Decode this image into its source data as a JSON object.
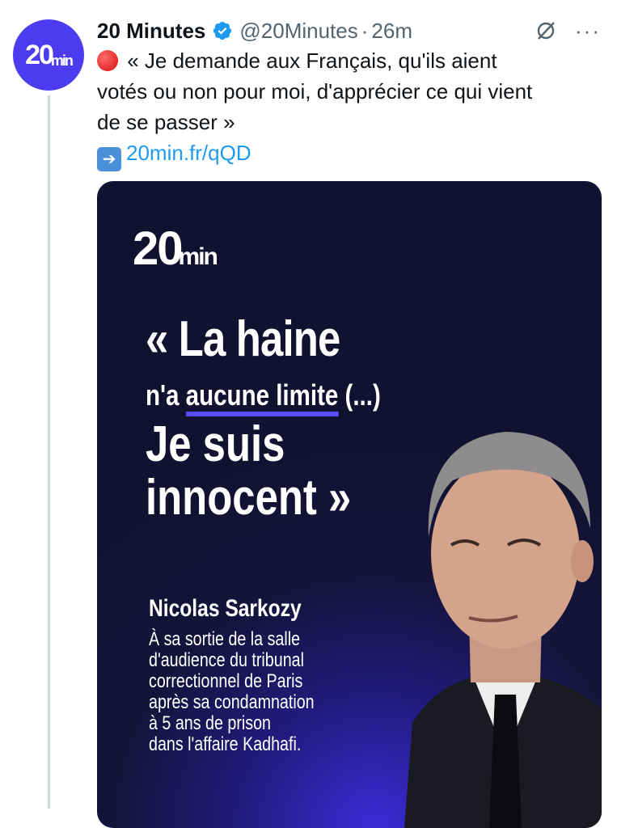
{
  "account": {
    "name": "20 Minutes",
    "handle": "@20Minutes",
    "separator": "·",
    "time": "26m",
    "avatar_logo": {
      "big": "20",
      "small": "min"
    }
  },
  "tweet": {
    "lines": [
      "« Je demande aux Français, qu'ils aient",
      "votés ou non pour moi, d'apprécier ce qui vient",
      "de se passer »"
    ],
    "link": "20min.fr/qQD"
  },
  "media": {
    "logo": {
      "big": "20",
      "small": "min"
    },
    "quote_line1": "« La haine",
    "quote_line2_pre": "n'a ",
    "quote_line2_highlight": "aucune limite",
    "quote_line2_post": " (...)",
    "quote_line3": "Je suis",
    "quote_line4": "innocent »",
    "person_name": "Nicolas Sarkozy",
    "caption_lines": [
      "À sa sortie de la salle",
      "d'audience du tribunal",
      "correctionnel de Paris",
      "après sa condamnation",
      "à 5 ans de prison",
      "dans l'affaire Kadhafi."
    ]
  },
  "icons": {
    "verified": "verified-badge-icon",
    "grok": "grok-icon",
    "more": "more-icon",
    "red_circle": "red-circle-emoji",
    "arrow": "right-arrow-emoji"
  },
  "colors": {
    "brand": "#4b3cf0",
    "link": "#1d9bf0",
    "verified": "#1d9bf0",
    "muted": "#536471"
  }
}
